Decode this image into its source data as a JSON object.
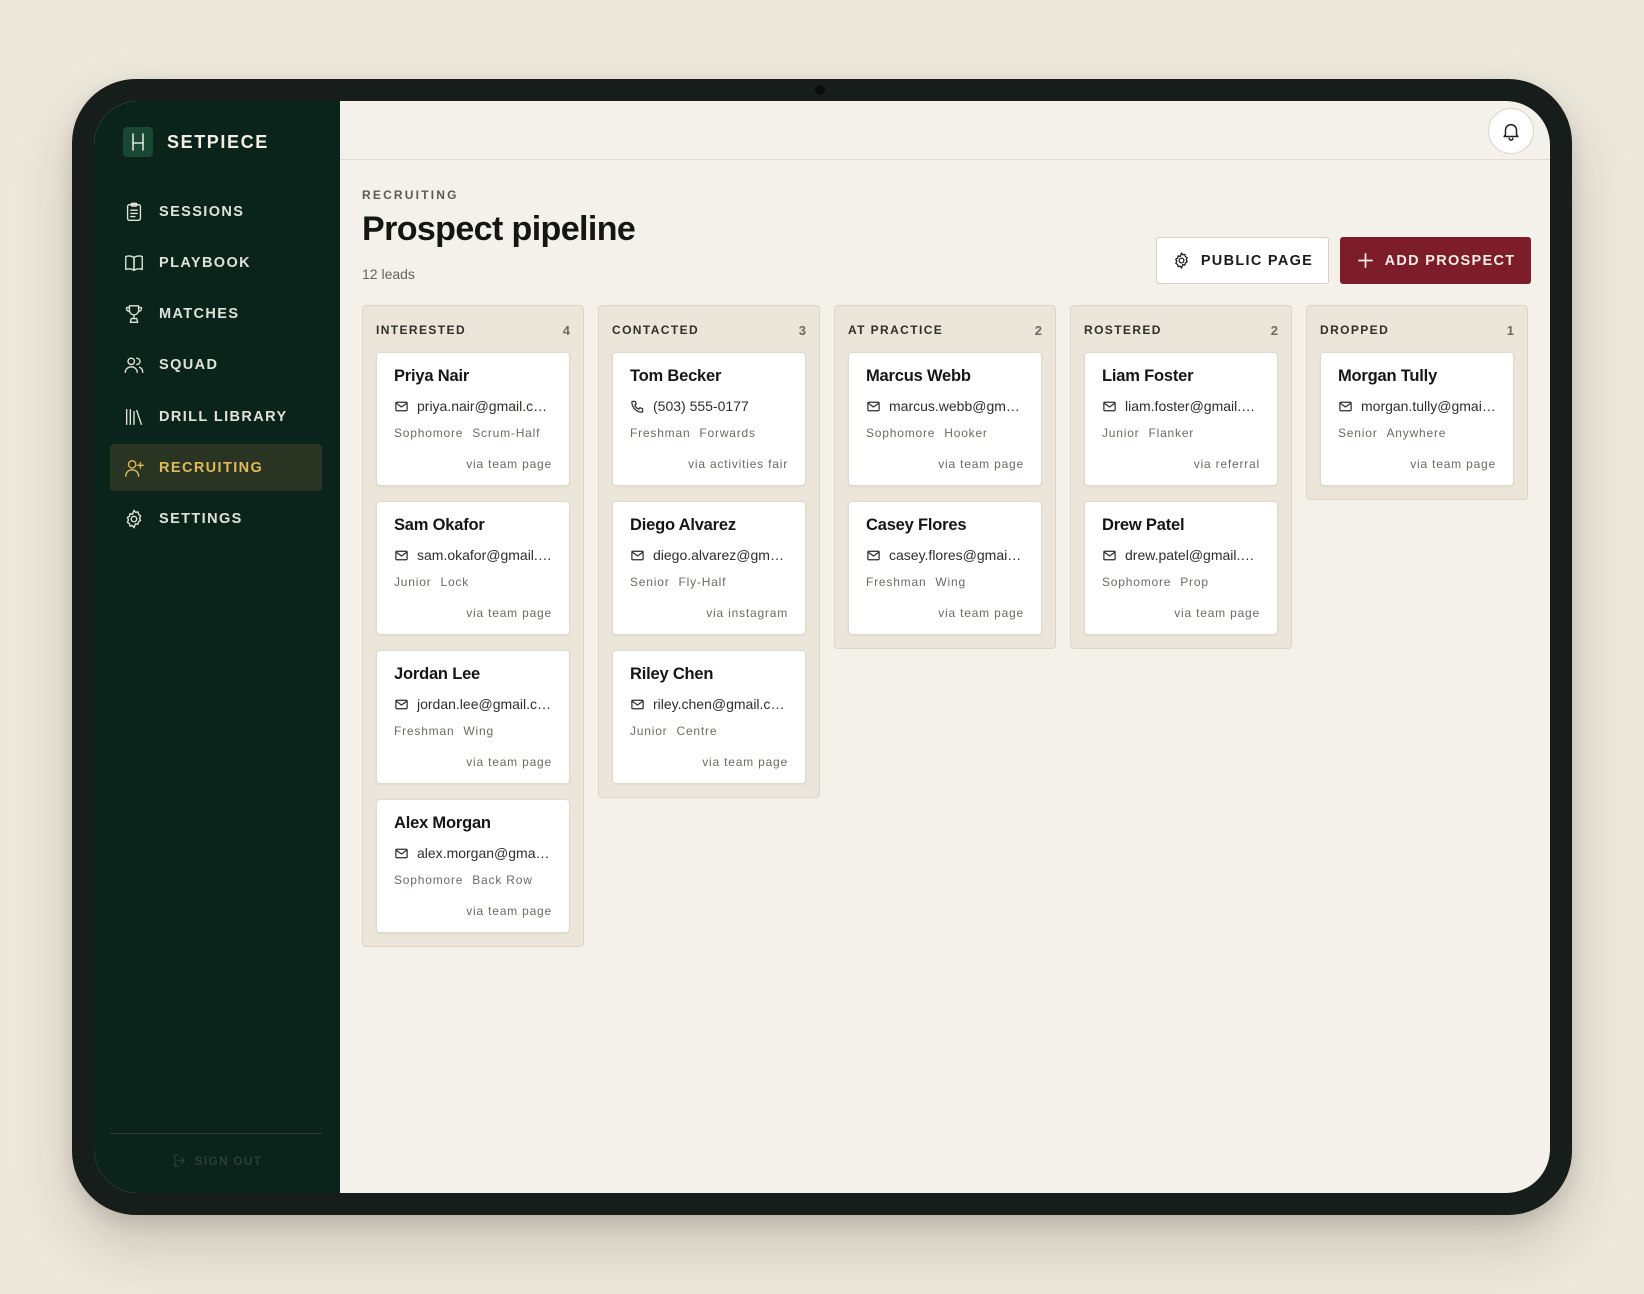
{
  "brand": {
    "name": "SETPIECE"
  },
  "nav": [
    {
      "id": "sessions",
      "label": "SESSIONS",
      "icon": "clipboard-icon",
      "active": false
    },
    {
      "id": "playbook",
      "label": "PLAYBOOK",
      "icon": "book-icon",
      "active": false
    },
    {
      "id": "matches",
      "label": "MATCHES",
      "icon": "trophy-icon",
      "active": false
    },
    {
      "id": "squad",
      "label": "SQUAD",
      "icon": "users-icon",
      "active": false
    },
    {
      "id": "drill-library",
      "label": "DRILL LIBRARY",
      "icon": "library-icon",
      "active": false
    },
    {
      "id": "recruiting",
      "label": "RECRUITING",
      "icon": "user-plus-icon",
      "active": true
    },
    {
      "id": "settings",
      "label": "SETTINGS",
      "icon": "gear-icon",
      "active": false
    }
  ],
  "signout": {
    "label": "SIGN OUT"
  },
  "page": {
    "eyebrow": "RECRUITING",
    "title": "Prospect pipeline",
    "lead_count": "12 leads"
  },
  "actions": {
    "public_page": "PUBLIC PAGE",
    "add_prospect": "ADD PROSPECT"
  },
  "colors": {
    "sidebar_bg": "#0b241b",
    "accent_active": "#e1b95b",
    "primary_button": "#7d1d2a",
    "page_bg": "#f4f1ea"
  },
  "columns": [
    {
      "name": "INTERESTED",
      "count": "4",
      "cards": [
        {
          "name": "Priya Nair",
          "contact_type": "email",
          "contact": "priya.nair@gmail.com",
          "year": "Sophomore",
          "position": "Scrum-Half",
          "source": "via team page"
        },
        {
          "name": "Sam Okafor",
          "contact_type": "email",
          "contact": "sam.okafor@gmail.com",
          "year": "Junior",
          "position": "Lock",
          "source": "via team page"
        },
        {
          "name": "Jordan Lee",
          "contact_type": "email",
          "contact": "jordan.lee@gmail.com",
          "year": "Freshman",
          "position": "Wing",
          "source": "via team page"
        },
        {
          "name": "Alex Morgan",
          "contact_type": "email",
          "contact": "alex.morgan@gmail.com",
          "year": "Sophomore",
          "position": "Back Row",
          "source": "via team page"
        }
      ]
    },
    {
      "name": "CONTACTED",
      "count": "3",
      "cards": [
        {
          "name": "Tom Becker",
          "contact_type": "phone",
          "contact": "(503) 555-0177",
          "year": "Freshman",
          "position": "Forwards",
          "source": "via activities fair"
        },
        {
          "name": "Diego Alvarez",
          "contact_type": "email",
          "contact": "diego.alvarez@gmail.com",
          "year": "Senior",
          "position": "Fly-Half",
          "source": "via instagram"
        },
        {
          "name": "Riley Chen",
          "contact_type": "email",
          "contact": "riley.chen@gmail.com",
          "year": "Junior",
          "position": "Centre",
          "source": "via team page"
        }
      ]
    },
    {
      "name": "AT PRACTICE",
      "count": "2",
      "cards": [
        {
          "name": "Marcus Webb",
          "contact_type": "email",
          "contact": "marcus.webb@gmail.com",
          "year": "Sophomore",
          "position": "Hooker",
          "source": "via team page"
        },
        {
          "name": "Casey Flores",
          "contact_type": "email",
          "contact": "casey.flores@gmail.com",
          "year": "Freshman",
          "position": "Wing",
          "source": "via team page"
        }
      ]
    },
    {
      "name": "ROSTERED",
      "count": "2",
      "cards": [
        {
          "name": "Liam Foster",
          "contact_type": "email",
          "contact": "liam.foster@gmail.com",
          "year": "Junior",
          "position": "Flanker",
          "source": "via referral"
        },
        {
          "name": "Drew Patel",
          "contact_type": "email",
          "contact": "drew.patel@gmail.com",
          "year": "Sophomore",
          "position": "Prop",
          "source": "via team page"
        }
      ]
    },
    {
      "name": "DROPPED",
      "count": "1",
      "cards": [
        {
          "name": "Morgan Tully",
          "contact_type": "email",
          "contact": "morgan.tully@gmail.com",
          "year": "Senior",
          "position": "Anywhere",
          "source": "via team page"
        }
      ]
    }
  ]
}
